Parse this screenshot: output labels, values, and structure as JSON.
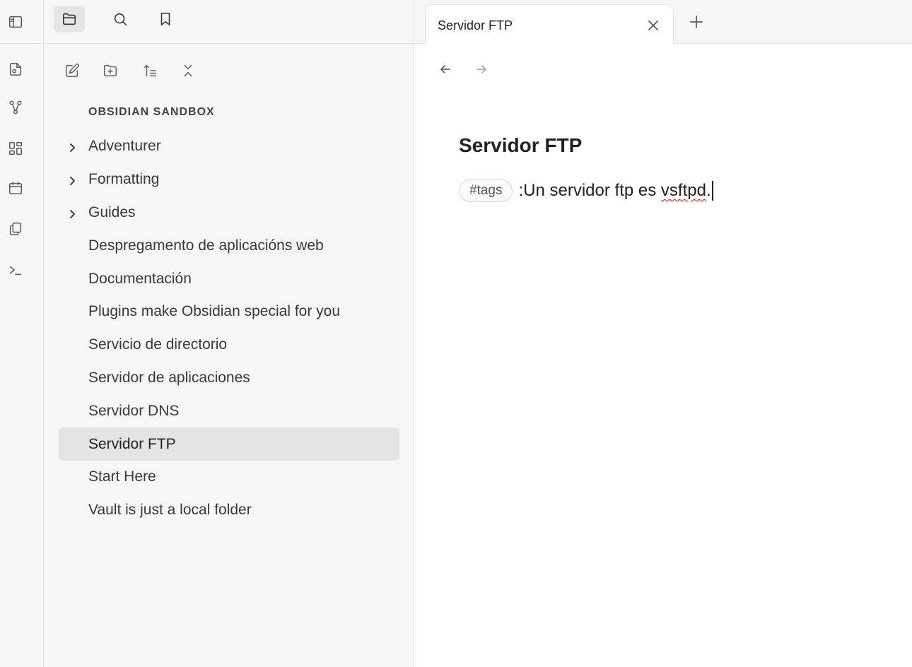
{
  "sidebar_header": {
    "buttons": [
      {
        "icon": "folder-icon",
        "name": "files-view"
      },
      {
        "icon": "search-icon",
        "name": "search-view"
      },
      {
        "icon": "bookmark-icon",
        "name": "bookmarks-view"
      }
    ]
  },
  "ribbon": {
    "icons": [
      "sidebar-toggle-icon",
      "quick-switcher-icon",
      "graph-icon",
      "canvas-icon",
      "calendar-icon",
      "templates-icon",
      "terminal-icon"
    ]
  },
  "toolbar": {
    "icons": [
      "new-note-icon",
      "new-folder-icon",
      "sort-icon",
      "collapse-all-icon"
    ]
  },
  "vault": {
    "name": "OBSIDIAN SANDBOX"
  },
  "tree": {
    "items": [
      {
        "label": "Adventurer",
        "type": "folder",
        "selected": false
      },
      {
        "label": "Formatting",
        "type": "folder",
        "selected": false
      },
      {
        "label": "Guides",
        "type": "folder",
        "selected": false
      },
      {
        "label": "Despregamento de aplicacións web",
        "type": "file",
        "selected": false
      },
      {
        "label": "Documentación",
        "type": "file",
        "selected": false
      },
      {
        "label": "Plugins make Obsidian special for you",
        "type": "file",
        "selected": false
      },
      {
        "label": "Servicio de directorio",
        "type": "file",
        "selected": false
      },
      {
        "label": "Servidor de aplicaciones",
        "type": "file",
        "selected": false
      },
      {
        "label": "Servidor DNS",
        "type": "file",
        "selected": false
      },
      {
        "label": "Servidor FTP",
        "type": "file",
        "selected": true
      },
      {
        "label": "Start Here",
        "type": "file",
        "selected": false
      },
      {
        "label": "Vault is just a local folder",
        "type": "file",
        "selected": false
      }
    ]
  },
  "tabs": {
    "active": {
      "title": "Servidor FTP"
    }
  },
  "note": {
    "title": "Servidor FTP",
    "tag": "#tags",
    "text_before": ":Un servidor ftp es ",
    "misspelled": "vsftpd",
    "text_after": "."
  }
}
